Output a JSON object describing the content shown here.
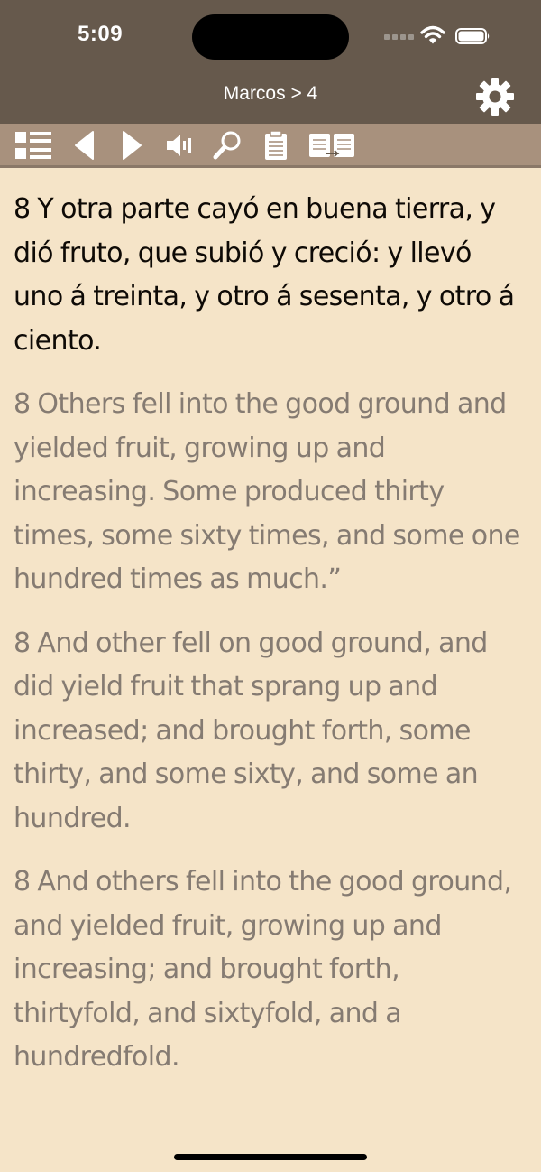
{
  "status": {
    "time": "5:09"
  },
  "nav": {
    "title": "Marcos > 4"
  },
  "toolbar": {
    "icons": [
      "list-icon",
      "previous-icon",
      "next-icon",
      "speaker-icon",
      "search-icon",
      "notes-icon",
      "compare-icon"
    ]
  },
  "verses": [
    {
      "text": "8  Y otra parte cayó en buena tierra, y dió fruto, que subió y creció: y llevó uno á treinta, y otro á sesenta, y otro á ciento."
    },
    {
      "text": "8  Others fell into the good ground and yielded fruit, growing up and increasing. Some produced thirty times, some sixty times, and some one hundred times as much.”"
    },
    {
      "text": "8  And other fell on good ground, and did yield fruit that sprang up and increased; and brought forth, some thirty, and some sixty, and some an hundred."
    },
    {
      "text": "8  And others fell into the good ground, and yielded fruit, growing up and increasing; and brought forth, thirtyfold, and sixtyfold, and a hundredfold."
    }
  ],
  "colors": {
    "bar": "#66594c",
    "toolbar": "#a8917d",
    "background": "#f5e4c8",
    "primary_text": "#0e0a06",
    "secondary_text": "#857b72"
  }
}
